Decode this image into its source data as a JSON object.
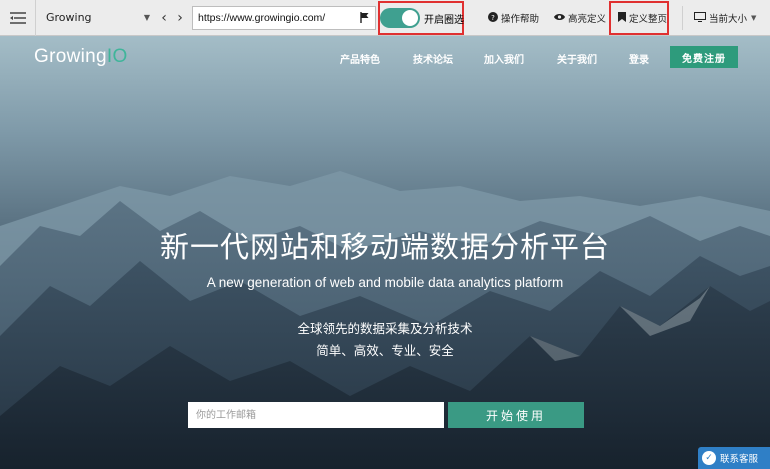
{
  "toolbar": {
    "project_name": "Growing",
    "url": "https://www.growingio.com/",
    "circle_toggle_label": "开启圈选",
    "circle_toggle_on": true,
    "help_label": "操作帮助",
    "highlight_label": "高亮定义",
    "define_page_label": "定义整页",
    "viewport_label": "当前大小"
  },
  "nav": {
    "logo_main": "Growing",
    "logo_io": "IO",
    "links": [
      "产品特色",
      "技术论坛",
      "加入我们",
      "关于我们",
      "登录"
    ],
    "signup_label": "免费注册"
  },
  "hero": {
    "headline": "新一代网站和移动端数据分析平台",
    "subline": "A new generation of web and mobile data analytics platform",
    "tagline1": "全球领先的数据采集及分析技术",
    "tagline2": "简单、高效、专业、安全",
    "email_placeholder": "你的工作邮箱",
    "start_label": "开始使用"
  },
  "support": {
    "label": "联系客服"
  },
  "colors": {
    "accent": "#3fa090",
    "highlight_border": "#e03030",
    "support": "#2f7fc6"
  }
}
